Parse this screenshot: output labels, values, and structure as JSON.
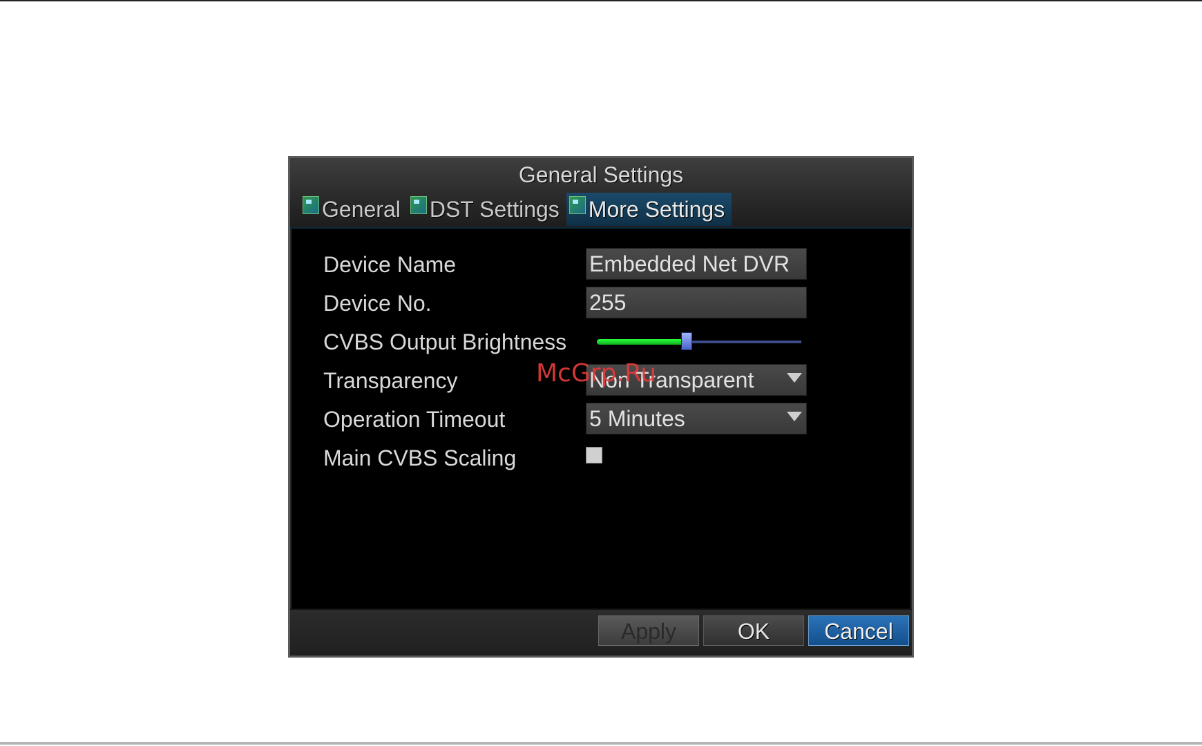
{
  "dialog": {
    "title": "General Settings",
    "tabs": [
      {
        "label": "General",
        "active": false
      },
      {
        "label": "DST Settings",
        "active": false
      },
      {
        "label": "More Settings",
        "active": true
      }
    ],
    "fields": {
      "device_name": {
        "label": "Device Name",
        "value": "Embedded Net DVR"
      },
      "device_no": {
        "label": "Device No.",
        "value": "255"
      },
      "cvbs_brightness": {
        "label": "CVBS Output Brightness",
        "level": 0.44
      },
      "transparency": {
        "label": "Transparency",
        "value": "Non Transparent"
      },
      "operation_timeout": {
        "label": "Operation Timeout",
        "value": "5 Minutes"
      },
      "main_cvbs_scaling": {
        "label": "Main CVBS Scaling",
        "checked": false
      }
    },
    "buttons": {
      "apply": "Apply",
      "ok": "OK",
      "cancel": "Cancel"
    }
  },
  "watermark": "McGrp.Ru",
  "colors": {
    "slider_fill": "#22e632",
    "active_tab": "#1b4a6a",
    "cancel_button": "#1f63a6"
  }
}
